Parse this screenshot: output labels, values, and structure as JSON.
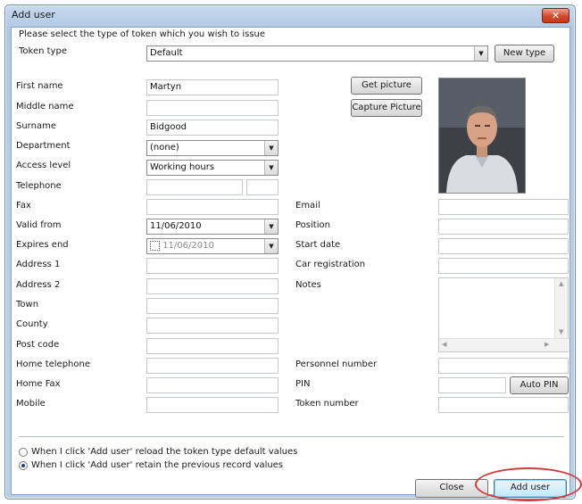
{
  "window": {
    "title": "Add user",
    "close_glyph": "✕"
  },
  "intro": "Please select the type of token which you wish to issue",
  "token_type": {
    "label": "Token type",
    "value": "Default",
    "new_type_button": "New type"
  },
  "buttons": {
    "get_picture": "Get picture",
    "capture_picture": "Capture Picture",
    "auto_pin": "Auto PIN",
    "close": "Close",
    "add_user": "Add user"
  },
  "fields": {
    "first_name": {
      "label": "First name",
      "value": "Martyn"
    },
    "middle_name": {
      "label": "Middle name",
      "value": ""
    },
    "surname": {
      "label": "Surname",
      "value": "Bidgood"
    },
    "department": {
      "label": "Department",
      "value": "(none)"
    },
    "access_level": {
      "label": "Access level",
      "value": "Working hours"
    },
    "telephone": {
      "label": "Telephone",
      "value": ""
    },
    "fax": {
      "label": "Fax",
      "value": ""
    },
    "valid_from": {
      "label": "Valid from",
      "value": "11/06/2010"
    },
    "expires_end": {
      "label": "Expires end",
      "value": "11/06/2010"
    },
    "address1": {
      "label": "Address 1",
      "value": ""
    },
    "address2": {
      "label": "Address 2",
      "value": ""
    },
    "town": {
      "label": "Town",
      "value": ""
    },
    "county": {
      "label": "County",
      "value": ""
    },
    "post_code": {
      "label": "Post code",
      "value": ""
    },
    "home_telephone": {
      "label": "Home telephone",
      "value": ""
    },
    "home_fax": {
      "label": "Home Fax",
      "value": ""
    },
    "mobile": {
      "label": "Mobile",
      "value": ""
    },
    "email": {
      "label": "Email",
      "value": ""
    },
    "position": {
      "label": "Position",
      "value": ""
    },
    "start_date": {
      "label": "Start date",
      "value": ""
    },
    "car_registration": {
      "label": "Car registration",
      "value": ""
    },
    "notes": {
      "label": "Notes",
      "value": ""
    },
    "personnel_number": {
      "label": "Personnel number",
      "value": ""
    },
    "pin": {
      "label": "PIN",
      "value": ""
    },
    "token_number": {
      "label": "Token number",
      "value": ""
    }
  },
  "options": {
    "reload": {
      "label": "When I click 'Add user' reload the token type default values",
      "selected": false
    },
    "retain": {
      "label": "When I click 'Add user' retain the previous record values",
      "selected": true
    }
  },
  "colors": {
    "highlight": "#d23a3a",
    "title_bar": "#c9daee"
  }
}
